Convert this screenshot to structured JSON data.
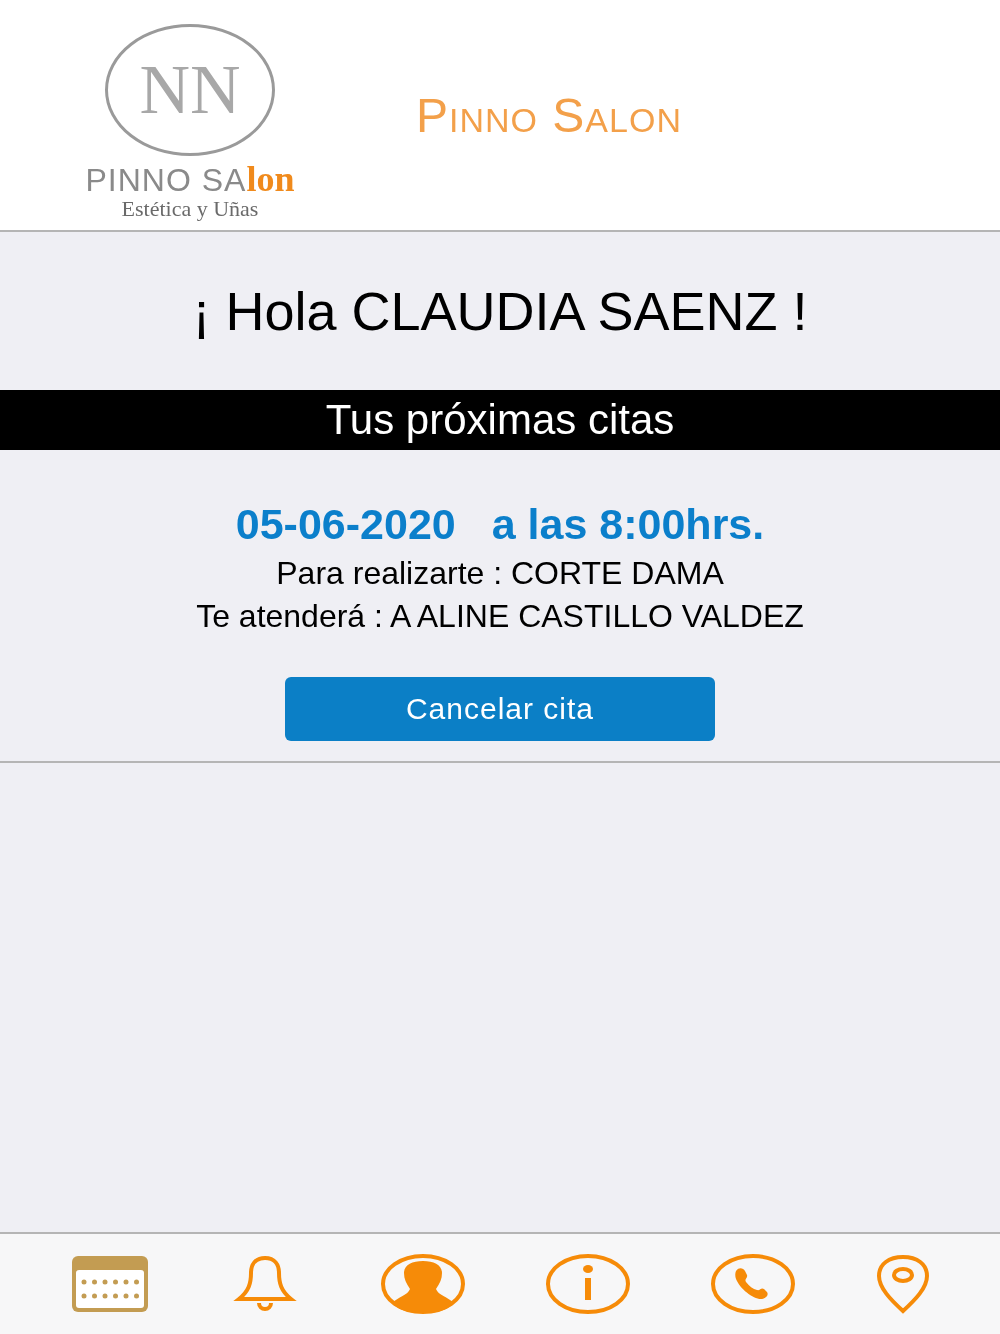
{
  "header": {
    "logo": {
      "monogram": "NN",
      "name_main": "PINNO SA",
      "name_accent": "lon",
      "tagline": "Estética y Uñas"
    },
    "title": "Pinno Salon"
  },
  "greeting": "¡ Hola CLAUDIA SAENZ !",
  "section_title": "Tus próximas citas",
  "appointments": [
    {
      "date": "05-06-2020",
      "time": "a las 8:00hrs.",
      "service": "Para realizarte : CORTE DAMA",
      "stylist": "Te atenderá : A ALINE CASTILLO VALDEZ",
      "button": "Cancelar cita"
    }
  ],
  "tab_bar": [
    {
      "kind": "calendar",
      "selected": true
    },
    {
      "kind": "bell",
      "selected": false
    },
    {
      "kind": "profile",
      "selected": false
    },
    {
      "kind": "info",
      "selected": false
    },
    {
      "kind": "phone",
      "selected": false
    },
    {
      "kind": "location",
      "selected": false
    }
  ]
}
